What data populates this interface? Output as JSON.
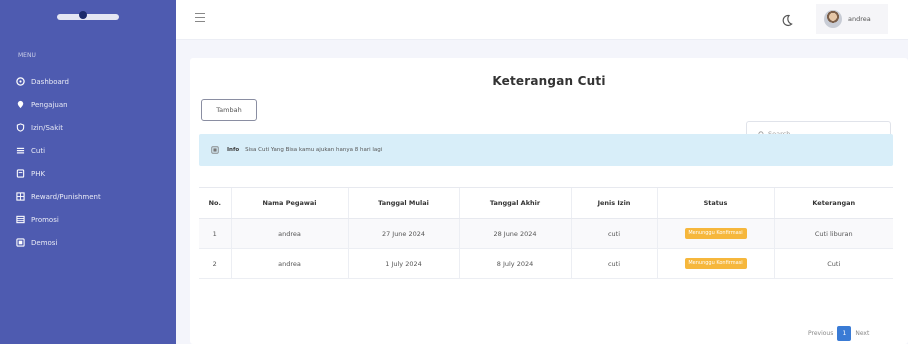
{
  "sidebar": {
    "menu_caption": "MENU",
    "items": [
      {
        "label": "Dashboard",
        "icon": "dashboard-icon"
      },
      {
        "label": "Pengajuan",
        "icon": "location-pin-icon"
      },
      {
        "label": "Izin/Sakit",
        "icon": "shield-icon"
      },
      {
        "label": "Cuti",
        "icon": "list-icon"
      },
      {
        "label": "PHK",
        "icon": "document-icon"
      },
      {
        "label": "Reward/Punishment",
        "icon": "grid-icon"
      },
      {
        "label": "Promosi",
        "icon": "stack-icon"
      },
      {
        "label": "Demosi",
        "icon": "folder-icon"
      }
    ]
  },
  "topbar": {
    "user_name": "andrea"
  },
  "main": {
    "title": "Keterangan Cuti",
    "add_button": "Tambah",
    "search_placeholder": "Search...",
    "alert_label": "Info",
    "alert_text": "Sisa Cuti Yang Bisa kamu ajukan hanya 8 hari lagi",
    "table": {
      "headers": [
        "No.",
        "Nama Pegawai",
        "Tanggal Mulai",
        "Tanggal Akhir",
        "Jenis Izin",
        "Status",
        "Keterangan"
      ],
      "rows": [
        {
          "no": "1",
          "nama": "andrea",
          "mulai": "27 June 2024",
          "akhir": "28 June 2024",
          "jenis": "cuti",
          "status": "Menunggu Konfirmasi",
          "keterangan": "Cuti liburan"
        },
        {
          "no": "2",
          "nama": "andrea",
          "mulai": "1 July 2024",
          "akhir": "8 July 2024",
          "jenis": "cuti",
          "status": "Menunggu Konfirmasi",
          "keterangan": "Cuti"
        }
      ]
    },
    "pagination": {
      "prev": "Previous",
      "current": "1",
      "next": "Next"
    }
  },
  "colors": {
    "sidebar": "#4e5bb0",
    "accent": "#3a7bd5",
    "badge": "#f6b73c",
    "alert": "#d8eef9"
  }
}
